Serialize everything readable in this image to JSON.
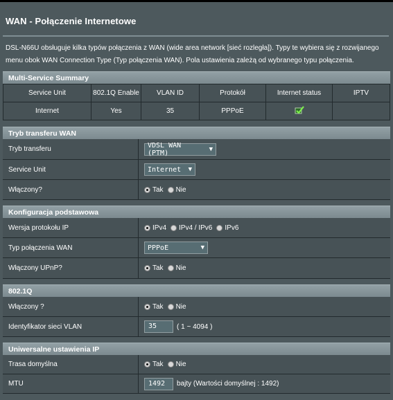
{
  "header": {
    "title": "WAN - Połączenie Internetowe",
    "description": "DSL-N66U obsługuje kilka typów połączenia z WAN (wide area network [sieć rozległa]). Typy te wybiera się z rozwijanego menu obok WAN Connection Type (Typ połączenia WAN). Pola ustawienia zależą od wybranego typu połączenia."
  },
  "summary": {
    "title": "Multi-Service Summary",
    "columns": [
      "Service Unit",
      "802.1Q Enable",
      "VLAN ID",
      "Protokół",
      "Internet status",
      "IPTV"
    ],
    "row": {
      "service_unit": "Internet",
      "enable_8021q": "Yes",
      "vlan_id": "35",
      "protocol": "PPPoE",
      "internet_status_icon": "check-icon",
      "iptv": ""
    }
  },
  "transfer": {
    "title": "Tryb transferu WAN",
    "mode_label": "Tryb transferu",
    "mode_value": "VDSL WAN (PTM)",
    "unit_label": "Service Unit",
    "unit_value": "Internet",
    "enabled_label": "Włączony?",
    "yes": "Tak",
    "no": "Nie",
    "enabled": "Tak"
  },
  "basic": {
    "title": "Konfiguracja podstawowa",
    "ip_label": "Wersja protokołu IP",
    "ip_opt1": "IPv4",
    "ip_opt2": "IPv4 / IPv6",
    "ip_opt3": "IPv6",
    "ip_selected": "IPv4",
    "conn_label": "Typ połączenia WAN",
    "conn_value": "PPPoE",
    "upnp_label": "Włączony UPnP?",
    "yes": "Tak",
    "no": "Nie",
    "upnp": "Tak"
  },
  "vlan": {
    "title": "802.1Q",
    "enabled_label": "Włączony ?",
    "yes": "Tak",
    "no": "Nie",
    "enabled": "Tak",
    "id_label": "Identyfikator sieci VLAN",
    "id_value": "35",
    "id_range": "( 1 ~ 4094 )"
  },
  "universal": {
    "title": "Uniwersalne ustawienia IP",
    "route_label": "Trasa domyślna",
    "yes": "Tak",
    "no": "Nie",
    "route": "Tak",
    "mtu_label": "MTU",
    "mtu_value": "1492",
    "mtu_hint": "bajty (Wartości domyślnej : 1492)"
  },
  "colors": {
    "background": "#4d595d",
    "section_header": "#8a989d",
    "status_ok": "#5ec43a"
  }
}
